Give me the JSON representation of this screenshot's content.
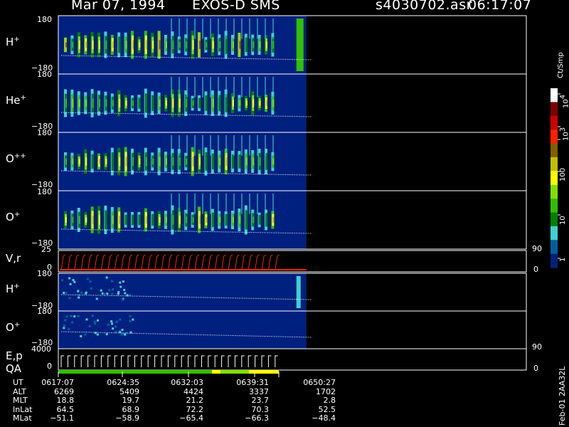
{
  "header": {
    "date": "Mar 07, 1994",
    "instrument": "EXOS-D SMS",
    "file": "s4030702.asr",
    "time": "06:17:07"
  },
  "panels": {
    "h_plus": {
      "label": "H",
      "sup": "+",
      "top_tick": "180",
      "bottom_tick": "−180"
    },
    "he_plus": {
      "label": "He",
      "sup": "+",
      "top_tick": "180",
      "bottom_tick": "−180"
    },
    "o_pp": {
      "label": "O",
      "sup": "++",
      "top_tick": "180",
      "bottom_tick": "−180"
    },
    "o_plus": {
      "label": "O",
      "sup": "+",
      "top_tick": "180",
      "bottom_tick": "−180"
    },
    "vr": {
      "label": "V,r",
      "top_tick": "25",
      "bottom_tick": "0",
      "right_top": "90",
      "right_bottom": "0"
    },
    "h_plus2": {
      "label": "H",
      "sup": "+",
      "top_tick": "180",
      "bottom_tick": "−180"
    },
    "o_plus2": {
      "label": "O",
      "sup": "+",
      "top_tick": "180",
      "bottom_tick": "−180"
    },
    "ep": {
      "label1": "E,p",
      "label2": "QA",
      "top_tick": "4000",
      "bottom_tick": "0",
      "right_top": "90",
      "right_bottom": "0"
    }
  },
  "colorbar": {
    "title": "Ct/Smp",
    "labels": [
      "10",
      "4",
      "10",
      "3",
      "100",
      "10",
      "1"
    ],
    "colors": [
      "#ffffff",
      "#7f0000",
      "#cc0000",
      "#ff2000",
      "#806000",
      "#c0c000",
      "#ffff00",
      "#80e000",
      "#30c000",
      "#008000",
      "#40d0d0",
      "#0060a0",
      "#00207f"
    ]
  },
  "footer_side": "Feb-01  2AA32L",
  "ephemeris": {
    "rows": [
      {
        "label": "UT",
        "values": [
          "0617:07",
          "0624:35",
          "0632:03",
          "0639:31",
          "0650:27"
        ]
      },
      {
        "label": "ALT",
        "values": [
          "6269",
          "5409",
          "4424",
          "3337",
          "1702"
        ]
      },
      {
        "label": "MLT",
        "values": [
          "18.8",
          "19.7",
          "21.2",
          "23.7",
          "2.8"
        ]
      },
      {
        "label": "InLat",
        "values": [
          "64.5",
          "68.9",
          "72.2",
          "70.3",
          "52.5"
        ]
      },
      {
        "label": "MLat",
        "values": [
          "−51.1",
          "−58.9",
          "−65.4",
          "−66.3",
          "−48.4"
        ]
      }
    ]
  },
  "chart_data": {
    "type": "heatmap",
    "title": "Mar 07, 1994   EXOS-D SMS",
    "x_ticks": [
      "0617:07",
      "0624:35",
      "0632:03",
      "0639:31",
      "0650:27"
    ],
    "panels": [
      {
        "name": "H+",
        "ylim": [
          -180,
          180
        ]
      },
      {
        "name": "He+",
        "ylim": [
          -180,
          180
        ]
      },
      {
        "name": "O++",
        "ylim": [
          -180,
          180
        ]
      },
      {
        "name": "O+",
        "ylim": [
          -180,
          180
        ]
      },
      {
        "name": "V,r",
        "ylim": [
          0,
          25
        ],
        "right_ylim": [
          0,
          90
        ]
      },
      {
        "name": "H+",
        "ylim": [
          -180,
          180
        ]
      },
      {
        "name": "O+",
        "ylim": [
          -180,
          180
        ]
      },
      {
        "name": "E,p",
        "ylim": [
          0,
          4000
        ],
        "right_ylim": [
          0,
          90
        ]
      }
    ],
    "colorscale": {
      "label": "Ct/Smp",
      "range": [
        1,
        10000
      ],
      "log": true
    },
    "data_end_fraction": 0.53
  }
}
